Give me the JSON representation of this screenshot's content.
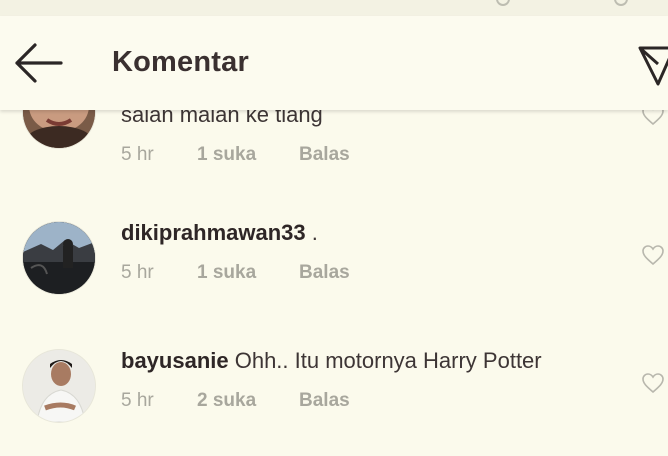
{
  "header": {
    "title": "Komentar",
    "back_icon": "arrow-left-icon",
    "send_icon": "paper-plane-icon"
  },
  "comments": [
    {
      "username": "",
      "text": "salah malah ke tiang",
      "time": "5 hr",
      "likes": "1 suka",
      "reply": "Balas"
    },
    {
      "username": "dikiprahmawan33",
      "text": " .",
      "time": "5 hr",
      "likes": "1 suka",
      "reply": "Balas"
    },
    {
      "username": "bayusanie",
      "text": " Ohh.. Itu motornya Harry Potter",
      "time": "5 hr",
      "likes": "2 suka",
      "reply": "Balas"
    }
  ],
  "colors": {
    "background": "#fbfaec",
    "text": "#2e2626",
    "muted": "#a8a79d"
  }
}
